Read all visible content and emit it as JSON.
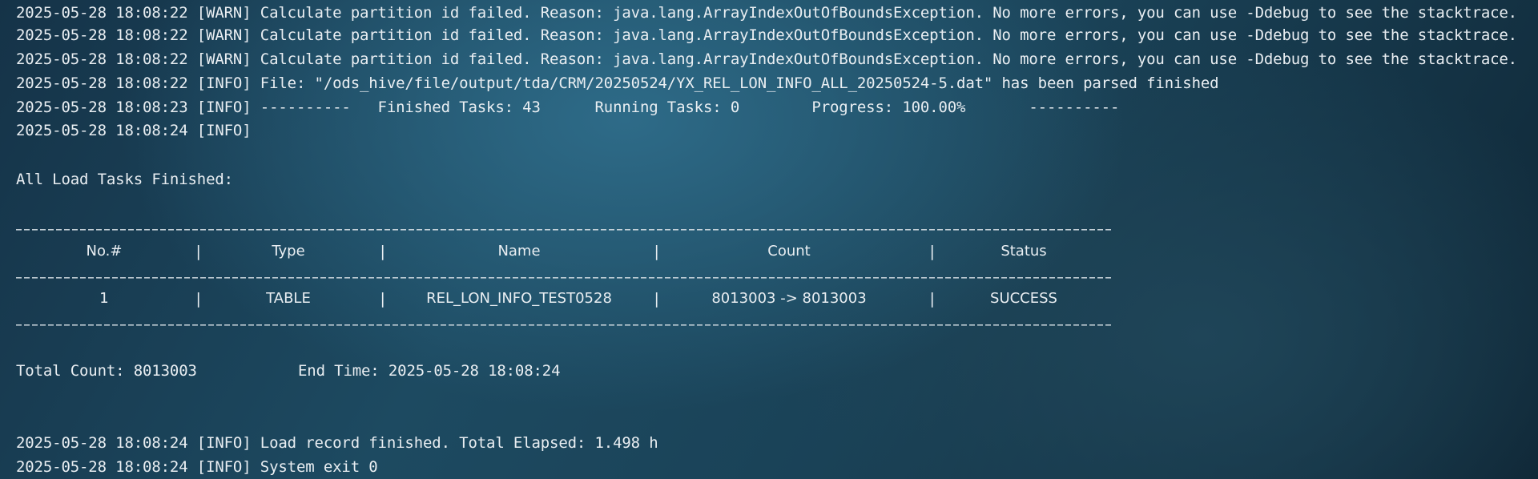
{
  "log_lines_top": [
    "2025-05-28 18:08:22 [WARN] Calculate partition id failed. Reason: java.lang.ArrayIndexOutOfBoundsException. No more errors, you can use -Ddebug to see the stacktrace.",
    "2025-05-28 18:08:22 [WARN] Calculate partition id failed. Reason: java.lang.ArrayIndexOutOfBoundsException. No more errors, you can use -Ddebug to see the stacktrace.",
    "2025-05-28 18:08:22 [WARN] Calculate partition id failed. Reason: java.lang.ArrayIndexOutOfBoundsException. No more errors, you can use -Ddebug to see the stacktrace.",
    "2025-05-28 18:08:22 [INFO] File: \"/ods_hive/file/output/tda/CRM/20250524/YX_REL_LON_INFO_ALL_20250524-5.dat\" has been parsed finished",
    "2025-05-28 18:08:23 [INFO] ----------   Finished Tasks: 43      Running Tasks: 0        Progress: 100.00%       ----------",
    "2025-05-28 18:08:24 [INFO]"
  ],
  "summary_heading": "All Load Tasks Finished:",
  "table": {
    "headers": {
      "no": "No.#",
      "type": "Type",
      "name": "Name",
      "count": "Count",
      "status": "Status"
    },
    "separator_char": "|",
    "rows": [
      {
        "no": "1",
        "type": "TABLE",
        "name": "REL_LON_INFO_TEST0528",
        "count": "8013003 -> 8013003",
        "status": "SUCCESS"
      }
    ]
  },
  "totals": {
    "total_count": "Total Count: 8013003",
    "end_time": "End Time: 2025-05-28 18:08:24"
  },
  "log_lines_bottom": [
    "2025-05-28 18:08:24 [INFO] Load record finished. Total Elapsed: 1.498 h",
    "2025-05-28 18:08:24 [INFO] System exit 0"
  ]
}
